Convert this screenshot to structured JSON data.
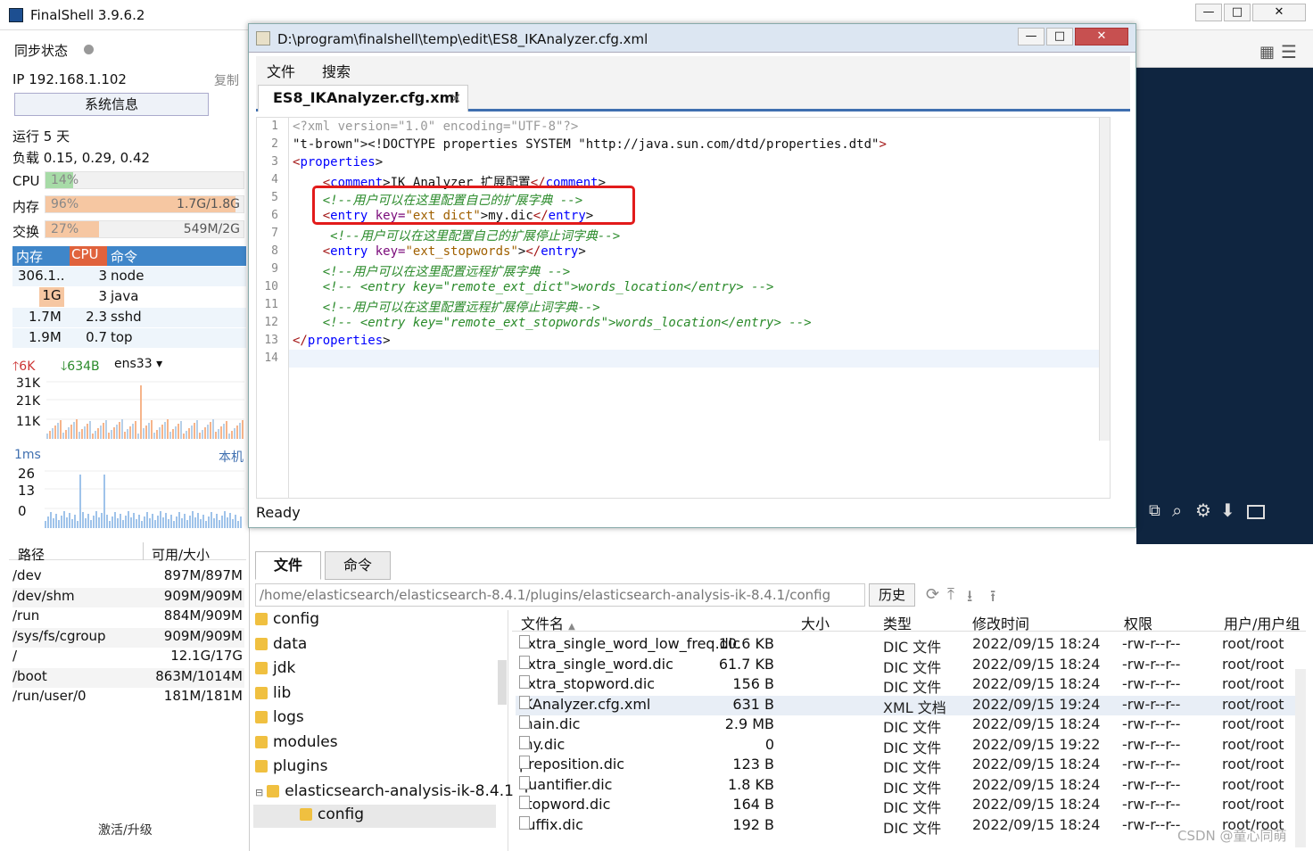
{
  "app": {
    "title": "FinalShell 3.9.6.2"
  },
  "window_controls": {
    "minimize": "—",
    "maximize": "□",
    "close": "✕"
  },
  "left": {
    "sync_label": "同步状态",
    "ip": "IP 192.168.1.102",
    "copy": "复制",
    "sysinfo_btn": "系统信息",
    "uptime": "运行 5 天",
    "load": "负载 0.15, 0.29, 0.42",
    "cpu": {
      "label": "CPU",
      "pct": "14%",
      "fill": 0.14
    },
    "mem": {
      "label": "内存",
      "pct": "96%",
      "val": "1.7G/1.8G",
      "fill": 0.96
    },
    "swap": {
      "label": "交换",
      "pct": "27%",
      "val": "549M/2G",
      "fill": 0.27
    },
    "proc_headers": [
      "内存",
      "CPU",
      "命令"
    ],
    "procs": [
      {
        "mem": "306.1..",
        "cpu": "3",
        "cmd": "node"
      },
      {
        "mem": "1G",
        "cpu": "3",
        "cmd": "java"
      },
      {
        "mem": "1.7M",
        "cpu": "2.3",
        "cmd": "sshd"
      },
      {
        "mem": "1.9M",
        "cpu": "0.7",
        "cmd": "top"
      }
    ],
    "net": {
      "up": "6K",
      "down": "634B",
      "iface": "ens33"
    },
    "net_ticks": [
      "31K",
      "21K",
      "11K"
    ],
    "ping": {
      "label": "1ms",
      "host": "本机",
      "ticks": [
        "26",
        "13",
        "0"
      ]
    },
    "disk_headers": [
      "路径",
      "可用/大小"
    ],
    "disks": [
      {
        "path": "/dev",
        "size": "897M/897M"
      },
      {
        "path": "/dev/shm",
        "size": "909M/909M"
      },
      {
        "path": "/run",
        "size": "884M/909M"
      },
      {
        "path": "/sys/fs/cgroup",
        "size": "909M/909M"
      },
      {
        "path": "/",
        "size": "12.1G/17G"
      },
      {
        "path": "/boot",
        "size": "863M/1014M"
      },
      {
        "path": "/run/user/0",
        "size": "181M/181M"
      }
    ],
    "activate": "激活/升级"
  },
  "editor": {
    "title": "D:\\program\\finalshell\\temp\\edit\\ES8_IKAnalyzer.cfg.xml",
    "menu": [
      "文件",
      "搜索"
    ],
    "tab": "ES8_IKAnalyzer.cfg.xml",
    "tab_close": "×",
    "status": "Ready",
    "lines": [
      "<?xml version=\"1.0\" encoding=\"UTF-8\"?>",
      "<!DOCTYPE properties SYSTEM \"http://java.sun.com/dtd/properties.dtd\">",
      "<properties>",
      "    <comment>IK Analyzer 扩展配置</comment>",
      "    <!--用户可以在这里配置自己的扩展字典 -->",
      "    <entry key=\"ext_dict\">my.dic</entry>",
      "     <!--用户可以在这里配置自己的扩展停止词字典-->",
      "    <entry key=\"ext_stopwords\"></entry>",
      "    <!--用户可以在这里配置远程扩展字典 -->",
      "    <!-- <entry key=\"remote_ext_dict\">words_location</entry> -->",
      "    <!--用户可以在这里配置远程扩展停止词字典-->",
      "    <!-- <entry key=\"remote_ext_stopwords\">words_location</entry> -->",
      "</properties>",
      ""
    ]
  },
  "bottom": {
    "tabs": [
      "文件",
      "命令"
    ],
    "path": "/home/elasticsearch/elasticsearch-8.4.1/plugins/elasticsearch-analysis-ik-8.4.1/config",
    "history": "历史",
    "tree": [
      "config",
      "data",
      "jdk",
      "lib",
      "logs",
      "modules",
      "plugins",
      "elasticsearch-analysis-ik-8.4.1",
      "config"
    ],
    "headers": [
      "文件名",
      "大小",
      "类型",
      "修改时间",
      "权限",
      "用户/用户组"
    ],
    "files": [
      {
        "name": "extra_single_word_low_freq.dic",
        "size": "10.6 KB",
        "type": "DIC 文件",
        "time": "2022/09/15 18:24",
        "perm": "-rw-r--r--",
        "owner": "root/root"
      },
      {
        "name": "extra_single_word.dic",
        "size": "61.7 KB",
        "type": "DIC 文件",
        "time": "2022/09/15 18:24",
        "perm": "-rw-r--r--",
        "owner": "root/root"
      },
      {
        "name": "extra_stopword.dic",
        "size": "156 B",
        "type": "DIC 文件",
        "time": "2022/09/15 18:24",
        "perm": "-rw-r--r--",
        "owner": "root/root"
      },
      {
        "name": "IKAnalyzer.cfg.xml",
        "size": "631 B",
        "type": "XML 文档",
        "time": "2022/09/15 19:24",
        "perm": "-rw-r--r--",
        "owner": "root/root"
      },
      {
        "name": "main.dic",
        "size": "2.9 MB",
        "type": "DIC 文件",
        "time": "2022/09/15 18:24",
        "perm": "-rw-r--r--",
        "owner": "root/root"
      },
      {
        "name": "my.dic",
        "size": "0",
        "type": "DIC 文件",
        "time": "2022/09/15 19:22",
        "perm": "-rw-r--r--",
        "owner": "root/root"
      },
      {
        "name": "preposition.dic",
        "size": "123 B",
        "type": "DIC 文件",
        "time": "2022/09/15 18:24",
        "perm": "-rw-r--r--",
        "owner": "root/root"
      },
      {
        "name": "quantifier.dic",
        "size": "1.8 KB",
        "type": "DIC 文件",
        "time": "2022/09/15 18:24",
        "perm": "-rw-r--r--",
        "owner": "root/root"
      },
      {
        "name": "stopword.dic",
        "size": "164 B",
        "type": "DIC 文件",
        "time": "2022/09/15 18:24",
        "perm": "-rw-r--r--",
        "owner": "root/root"
      },
      {
        "name": "suffix.dic",
        "size": "192 B",
        "type": "DIC 文件",
        "time": "2022/09/15 18:24",
        "perm": "-rw-r--r--",
        "owner": "root/root"
      }
    ]
  },
  "watermark": "CSDN @童心同萌"
}
